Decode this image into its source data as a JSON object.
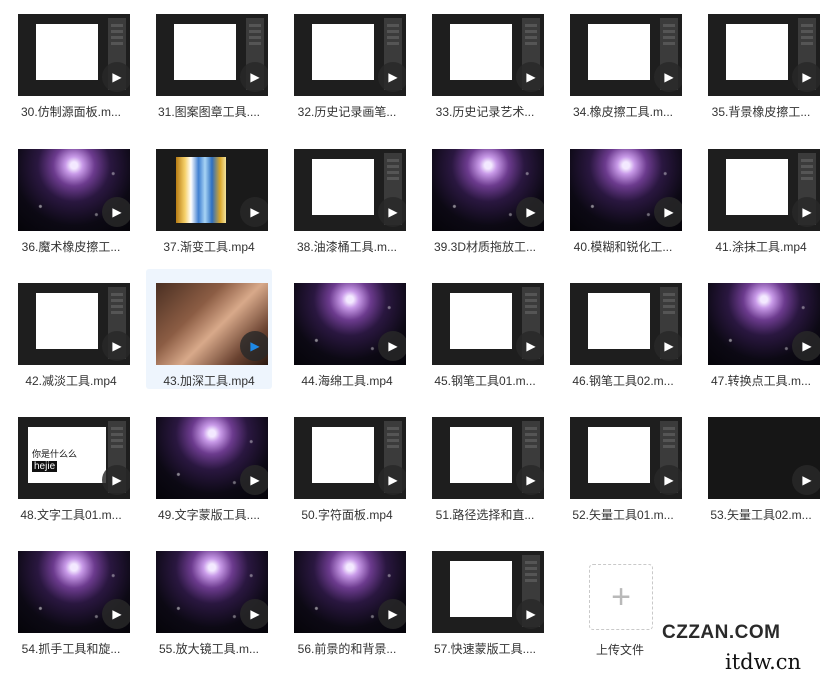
{
  "files": [
    {
      "label": "30.仿制源面板.m...",
      "thumb": "ps",
      "play": "white"
    },
    {
      "label": "31.图案图章工具....",
      "thumb": "ps",
      "play": "white"
    },
    {
      "label": "32.历史记录画笔...",
      "thumb": "ps",
      "play": "white"
    },
    {
      "label": "33.历史记录艺术...",
      "thumb": "ps",
      "play": "white"
    },
    {
      "label": "34.橡皮擦工具.m...",
      "thumb": "ps",
      "play": "white"
    },
    {
      "label": "35.背景橡皮擦工...",
      "thumb": "ps",
      "play": "white"
    },
    {
      "label": "36.魔术橡皮擦工...",
      "thumb": "space",
      "play": "white"
    },
    {
      "label": "37.渐变工具.mp4",
      "thumb": "gradient",
      "play": "white"
    },
    {
      "label": "38.油漆桶工具.m...",
      "thumb": "ps",
      "play": "white"
    },
    {
      "label": "39.3D材质拖放工...",
      "thumb": "space",
      "play": "white"
    },
    {
      "label": "40.模糊和锐化工...",
      "thumb": "space",
      "play": "white"
    },
    {
      "label": "41.涂抹工具.mp4",
      "thumb": "ps",
      "play": "white"
    },
    {
      "label": "42.减淡工具.mp4",
      "thumb": "ps",
      "play": "white"
    },
    {
      "label": "43.加深工具.mp4",
      "thumb": "face",
      "play": "blue",
      "selected": true
    },
    {
      "label": "44.海绵工具.mp4",
      "thumb": "space",
      "play": "white"
    },
    {
      "label": "45.钢笔工具01.m...",
      "thumb": "ps",
      "play": "white"
    },
    {
      "label": "46.钢笔工具02.m...",
      "thumb": "ps",
      "play": "white"
    },
    {
      "label": "47.转换点工具.m...",
      "thumb": "space",
      "play": "white"
    },
    {
      "label": "48.文字工具01.m...",
      "thumb": "ps",
      "play": "white"
    },
    {
      "label": "49.文字蒙版工具....",
      "thumb": "space",
      "play": "white"
    },
    {
      "label": "50.字符面板.mp4",
      "thumb": "ps",
      "play": "white"
    },
    {
      "label": "51.路径选择和直...",
      "thumb": "ps",
      "play": "white"
    },
    {
      "label": "52.矢量工具01.m...",
      "thumb": "ps",
      "play": "white"
    },
    {
      "label": "53.矢量工具02.m...",
      "thumb": "dark",
      "play": "white"
    },
    {
      "label": "54.抓手工具和旋...",
      "thumb": "space",
      "play": "white"
    },
    {
      "label": "55.放大镜工具.m...",
      "thumb": "space",
      "play": "white"
    },
    {
      "label": "56.前景的和背景...",
      "thumb": "space",
      "play": "white"
    },
    {
      "label": "57.快速蒙版工具....",
      "thumb": "ps",
      "play": "white"
    }
  ],
  "upload": {
    "label": "上传文件",
    "icon": "plus-icon"
  },
  "watermarks": {
    "line1": "CZZAN.COM",
    "line2": "itdw.cn"
  },
  "thumb_text": {
    "t48_line1": "你是什么么",
    "t48_line2": "hejie"
  },
  "colors": {
    "play_blue": "#1e88e5",
    "selected_bg": "#eef5fd"
  }
}
